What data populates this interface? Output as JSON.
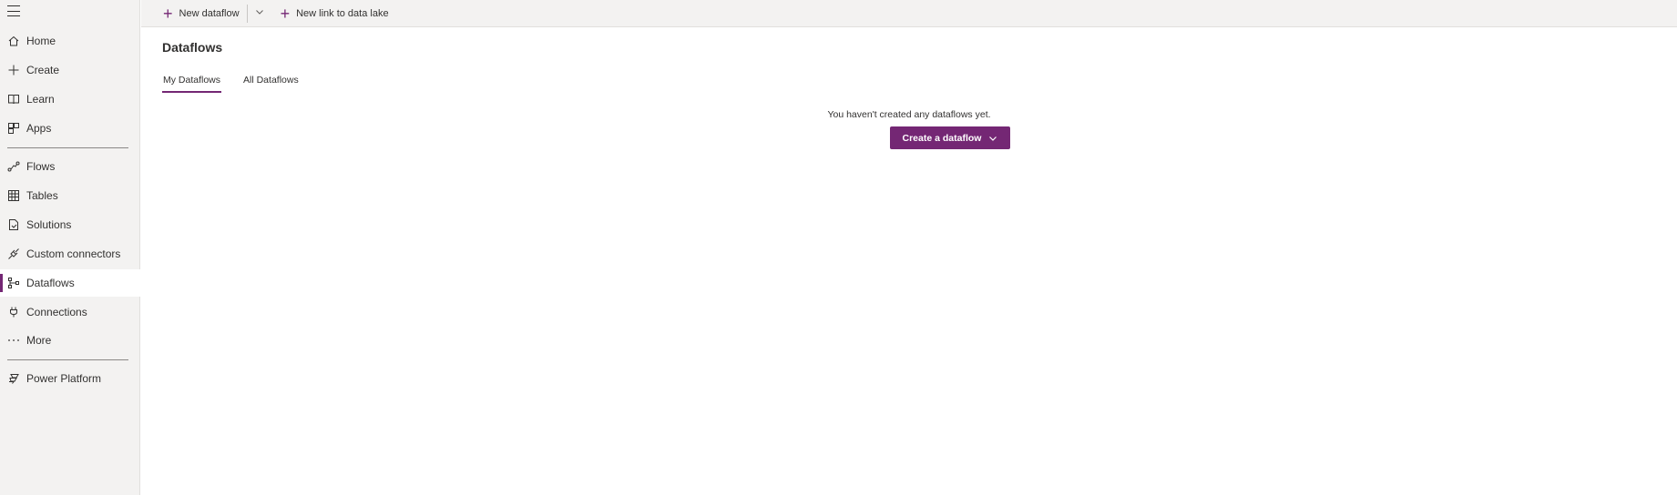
{
  "sidebar": {
    "items": [
      {
        "label": "Home",
        "icon": "home-icon"
      },
      {
        "label": "Create",
        "icon": "plus-icon"
      },
      {
        "label": "Learn",
        "icon": "book-icon"
      },
      {
        "label": "Apps",
        "icon": "apps-icon"
      },
      {
        "label": "Flows",
        "icon": "flow-icon"
      },
      {
        "label": "Tables",
        "icon": "table-icon"
      },
      {
        "label": "Solutions",
        "icon": "solutions-icon"
      },
      {
        "label": "Custom connectors",
        "icon": "connector-icon"
      },
      {
        "label": "Dataflows",
        "icon": "dataflow-icon",
        "selected": true
      },
      {
        "label": "Connections",
        "icon": "plug-icon"
      },
      {
        "label": "More",
        "icon": "more-icon"
      },
      {
        "label": "Power Platform",
        "icon": "power-platform-icon"
      }
    ]
  },
  "toolbar": {
    "new_dataflow": "New dataflow",
    "new_link": "New link to data lake"
  },
  "page": {
    "title": "Dataflows",
    "tabs": [
      {
        "label": "My Dataflows",
        "active": true
      },
      {
        "label": "All Dataflows",
        "active": false
      }
    ],
    "empty_message": "You haven't created any dataflows yet.",
    "create_button": "Create a dataflow"
  },
  "colors": {
    "accent": "#742774",
    "sidebar_bg": "#f3f2f1"
  }
}
